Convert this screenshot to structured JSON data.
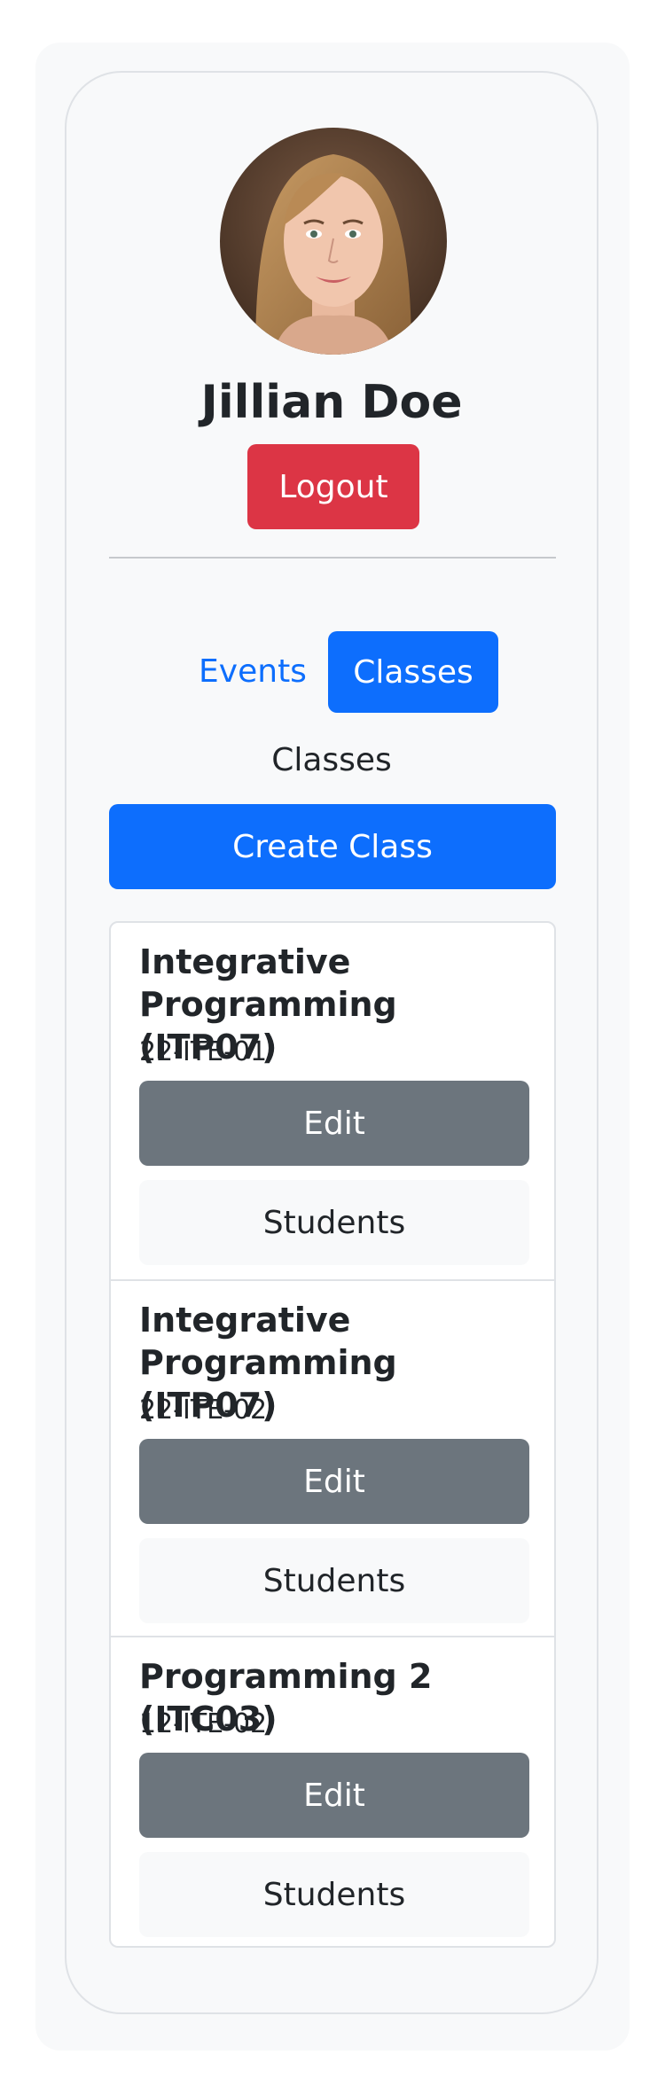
{
  "profile": {
    "name": "Jillian Doe",
    "logout_label": "Logout"
  },
  "tabs": [
    {
      "label": "Events",
      "active": false
    },
    {
      "label": "Classes",
      "active": true
    }
  ],
  "section_title": "Classes",
  "create_label": "Create Class",
  "classes": [
    {
      "title": "Integrative Programming (ITP07)",
      "code": "22-ITE-01",
      "edit_label": "Edit",
      "students_label": "Students"
    },
    {
      "title": "Integrative Programming (ITP07)",
      "code": "22-ITE-02",
      "edit_label": "Edit",
      "students_label": "Students"
    },
    {
      "title": "Programming 2 (ITC03)",
      "code": "12-ITE-02",
      "edit_label": "Edit",
      "students_label": "Students"
    }
  ],
  "colors": {
    "primary": "#0d6efd",
    "danger": "#dc3545",
    "secondary": "#6c757d",
    "light": "#f8f9fa"
  }
}
